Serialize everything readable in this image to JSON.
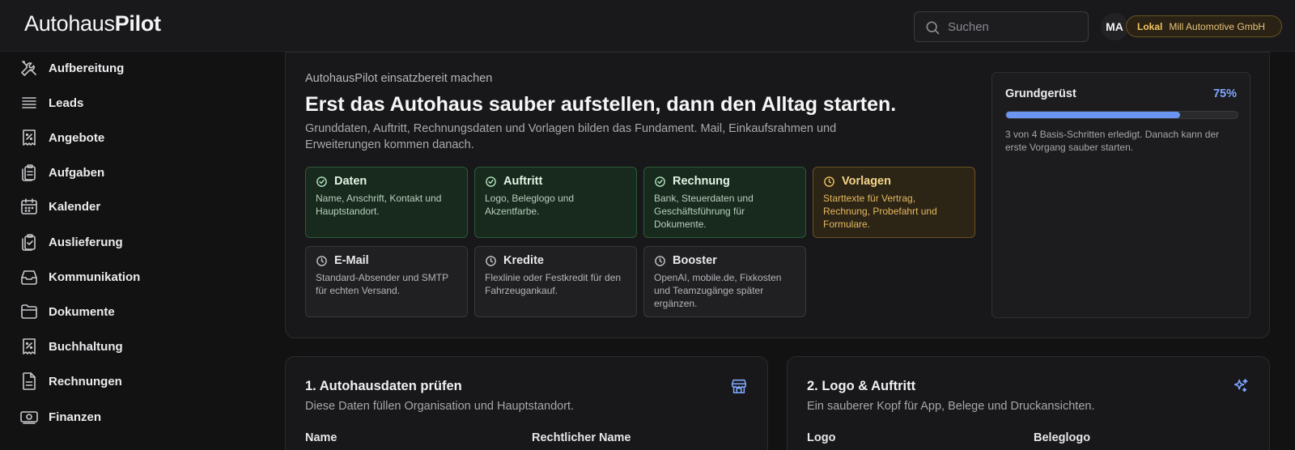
{
  "brand": {
    "part1": "Autohaus",
    "part2": "Pilot"
  },
  "search": {
    "placeholder": "Suchen",
    "icon": "search-icon"
  },
  "user": {
    "initials": "MA"
  },
  "org": {
    "mode": "Lokal",
    "name": "Mill Automotive GmbH"
  },
  "sidebar": {
    "items": [
      {
        "label": "Aufbereitung",
        "icon": "tools-icon"
      },
      {
        "label": "Leads",
        "icon": "list-icon"
      },
      {
        "label": "Angebote",
        "icon": "receipt-percent-icon"
      },
      {
        "label": "Aufgaben",
        "icon": "clipboard-icon"
      },
      {
        "label": "Kalender",
        "icon": "calendar-icon"
      },
      {
        "label": "Auslieferung",
        "icon": "clipboard-check-icon"
      },
      {
        "label": "Kommunikation",
        "icon": "inbox-icon"
      },
      {
        "label": "Dokumente",
        "icon": "folder-icon"
      },
      {
        "label": "Buchhaltung",
        "icon": "receipt-percent-icon"
      },
      {
        "label": "Rechnungen",
        "icon": "document-icon"
      },
      {
        "label": "Finanzen",
        "icon": "banknote-icon"
      }
    ]
  },
  "onboarding": {
    "kicker": "AutohausPilot einsatzbereit machen",
    "headline": "Erst das Autohaus sauber aufstellen, dann den Alltag starten.",
    "subtitle": "Grunddaten, Auftritt, Rechnungsdaten und Vorlagen bilden das Fundament. Mail, Einkaufsrahmen und Erweiterungen kommen danach.",
    "steps": [
      {
        "title": "Daten",
        "desc": "Name, Anschrift, Kontakt und Hauptstandort.",
        "status": "done"
      },
      {
        "title": "Auftritt",
        "desc": "Logo, Beleglogo und Akzentfarbe.",
        "status": "done"
      },
      {
        "title": "Rechnung",
        "desc": "Bank, Steuerdaten und Geschäftsführung für Dokumente.",
        "status": "done"
      },
      {
        "title": "Vorlagen",
        "desc": "Starttexte für Vertrag, Rechnung, Probefahrt und Formulare.",
        "status": "pending-highlight"
      },
      {
        "title": "E-Mail",
        "desc": "Standard-Absender und SMTP für echten Versand.",
        "status": "pending"
      },
      {
        "title": "Kredite",
        "desc": "Flexlinie oder Festkredit für den Fahrzeugankauf.",
        "status": "pending"
      },
      {
        "title": "Booster",
        "desc": "OpenAI, mobile.de, Fixkosten und Teamzugänge später ergänzen.",
        "status": "pending"
      }
    ],
    "progress": {
      "label": "Grundgerüst",
      "percent_text": "75%",
      "value": 0.75,
      "note": "3 von 4 Basis-Schritten erledigt. Danach kann der erste Vorgang sauber starten."
    }
  },
  "section1": {
    "title": "1. Autohausdaten prüfen",
    "subtitle": "Diese Daten füllen Organisation und Hauptstandort.",
    "field_left": "Name",
    "field_right": "Rechtlicher Name",
    "icon": "store-icon"
  },
  "section2": {
    "title": "2. Logo & Auftritt",
    "subtitle": "Ein sauberer Kopf für App, Belege und Druckansichten.",
    "field_left": "Logo",
    "field_right": "Beleglogo",
    "icon": "sparkles-icon"
  },
  "colors": {
    "done": "#2c5a36",
    "pending_highlight": "#6b5322",
    "progress": "#6a96f2",
    "accent_blue": "#7fa7ff"
  }
}
